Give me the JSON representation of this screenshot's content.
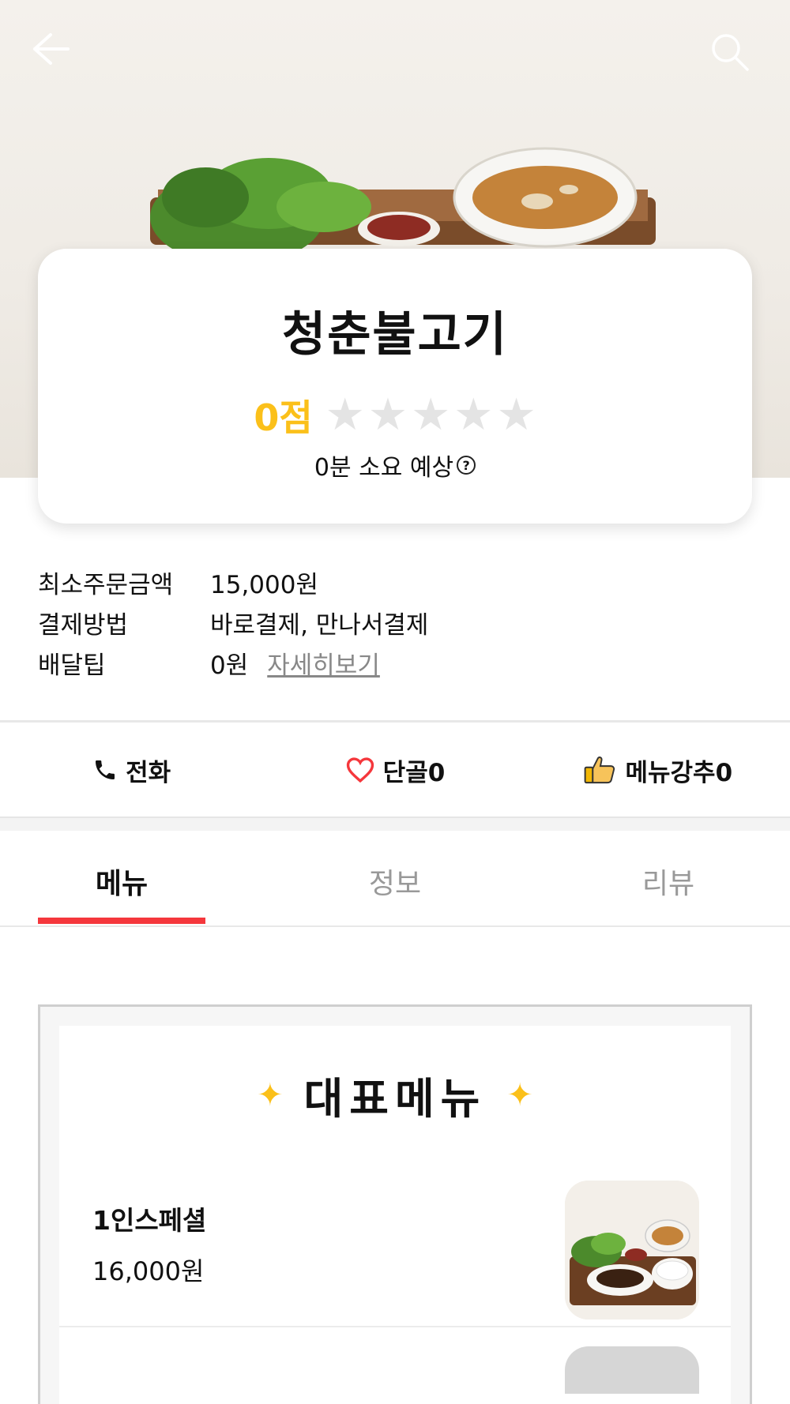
{
  "header": {
    "back_icon": "back-arrow-icon",
    "search_icon": "search-icon"
  },
  "store": {
    "name": "청춘불고기",
    "score": "0점",
    "stars_filled": 0,
    "stars_total": 5,
    "eta": "0분 소요 예상",
    "help_icon": "?"
  },
  "info": [
    {
      "label": "최소주문금액",
      "value": "15,000원"
    },
    {
      "label": "결제방법",
      "value": "바로결제, 만나서결제"
    },
    {
      "label": "배달팁",
      "value": "0원",
      "link": "자세히보기"
    }
  ],
  "actions": {
    "call": "전화",
    "favorite": "단골0",
    "recommend": "메뉴강추0"
  },
  "tabs": [
    "메뉴",
    "정보",
    "리뷰"
  ],
  "active_tab": "메뉴",
  "menu_section": {
    "title": "대표메뉴",
    "items": [
      {
        "name": "1인스페셜",
        "price": "16,000원"
      }
    ]
  },
  "colors": {
    "accent_red": "#f5373c",
    "score_yellow": "#fbc01a",
    "star_empty": "#e4e4e4"
  }
}
